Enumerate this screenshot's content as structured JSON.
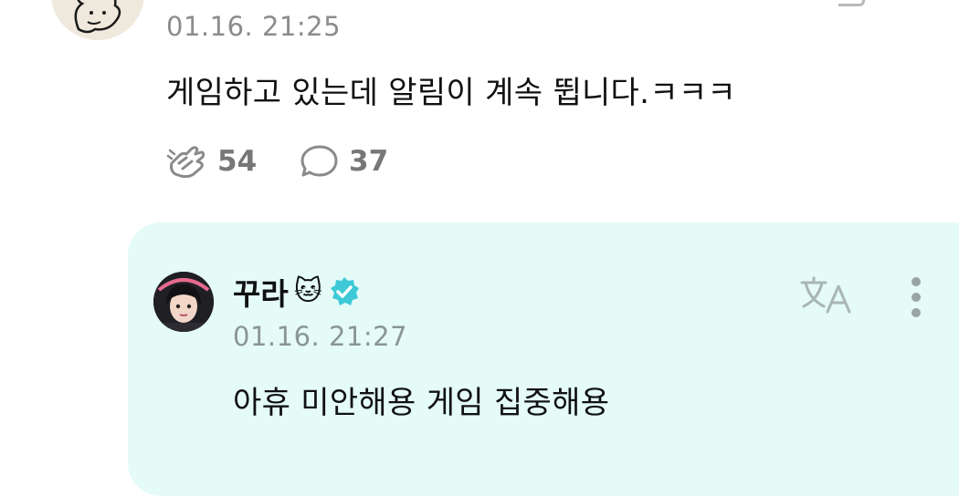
{
  "parent_comment": {
    "timestamp": "01.16. 21:25",
    "text": "게임하고 있는데 알림이 계속 뜁니다.ㅋㅋㅋ",
    "like_count": "54",
    "reply_count": "37"
  },
  "reply": {
    "author": "꾸라",
    "emoji": "🐱",
    "verified": true,
    "timestamp": "01.16. 21:27",
    "text": "아휴 미안해용 게임 집중해용"
  },
  "colors": {
    "reply_background": "#e4fbf8",
    "verified_badge": "#3ec9d6",
    "secondary_text": "#8c8c8c"
  },
  "icons": {
    "like": "cheer-hand-icon",
    "comment": "speech-bubble-icon",
    "translate": "translate-icon",
    "more": "more-vertical-icon",
    "verified": "verified-badge-icon"
  }
}
